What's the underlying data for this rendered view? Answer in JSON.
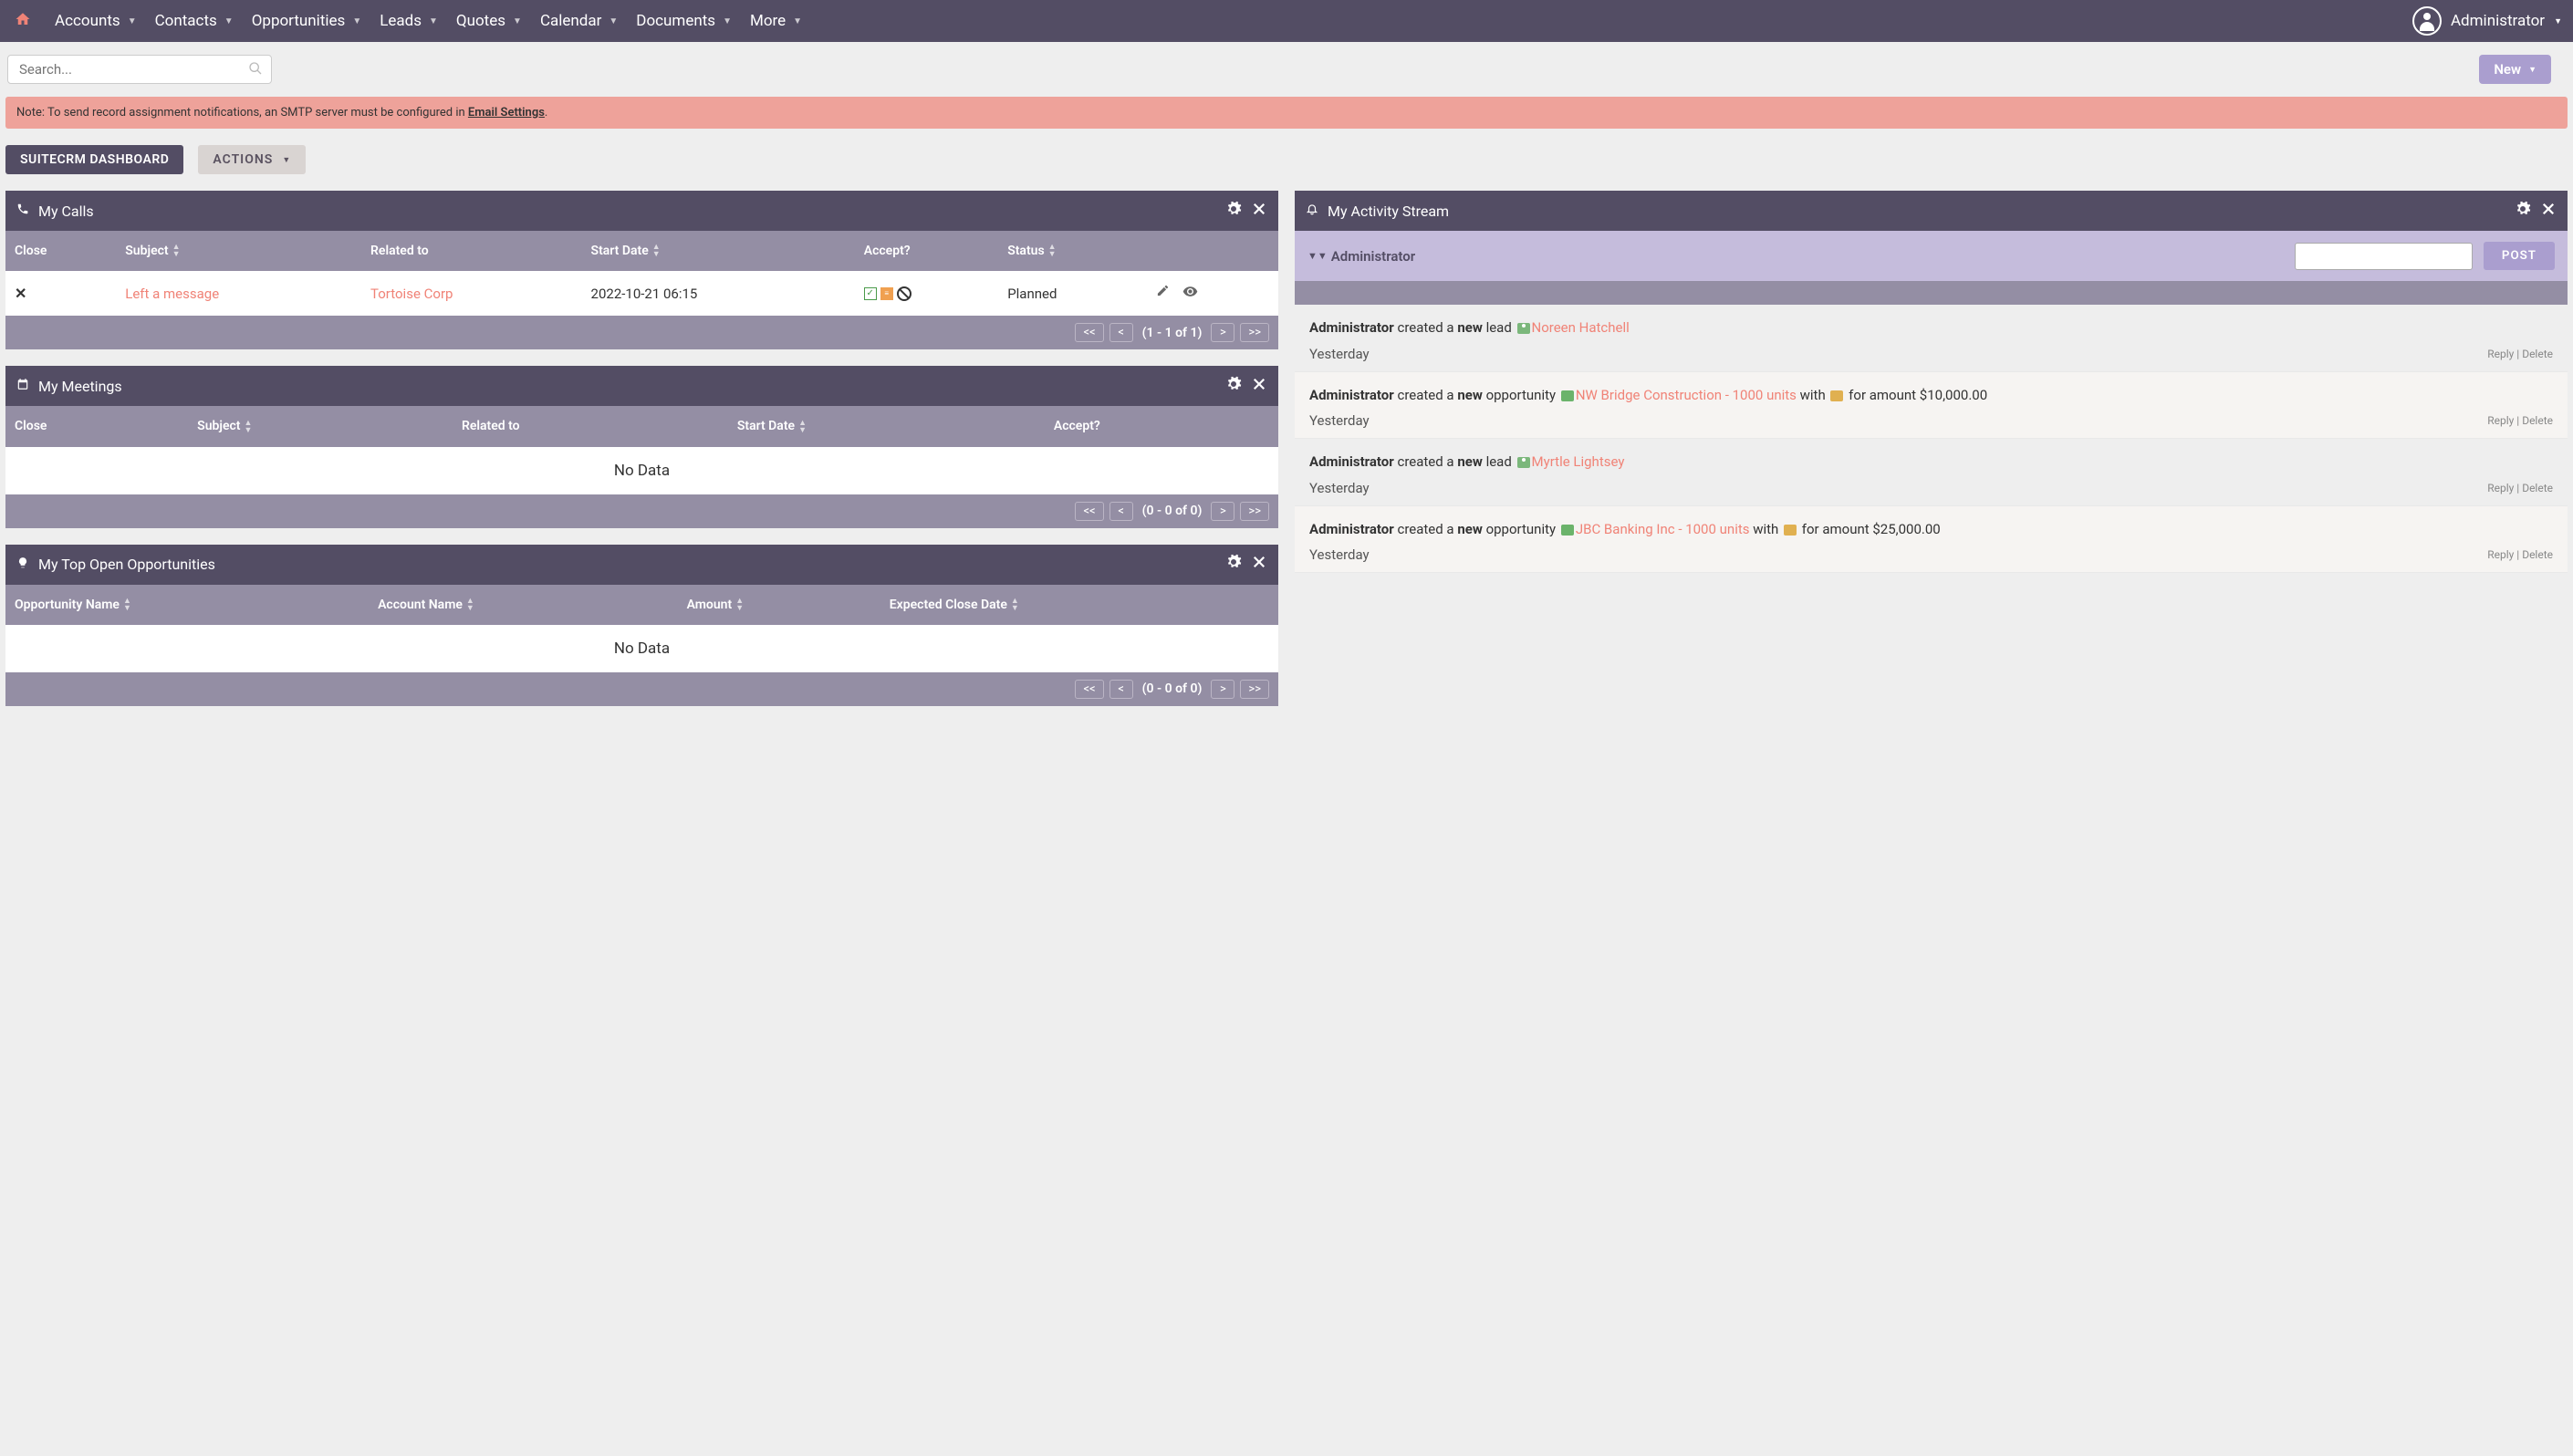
{
  "nav": {
    "items": [
      "Accounts",
      "Contacts",
      "Opportunities",
      "Leads",
      "Quotes",
      "Calendar",
      "Documents",
      "More"
    ],
    "user": "Administrator"
  },
  "search": {
    "placeholder": "Search..."
  },
  "new_btn": "New",
  "alert": {
    "prefix": "Note: To send record assignment notifications, an SMTP server must be configured in ",
    "link": "Email Settings",
    "suffix": "."
  },
  "dash_title": "SUITECRM DASHBOARD",
  "actions_btn": "ACTIONS",
  "labels": {
    "no_data": "No Data",
    "reply": "Reply",
    "delete": "Delete",
    "yesterday": "Yesterday",
    "post": "POST",
    "sep": " | "
  },
  "pager_btns": {
    "first": "<<",
    "prev": "<",
    "next": ">",
    "last": ">>"
  },
  "calls": {
    "title": "My Calls",
    "headers": {
      "close": "Close",
      "subject": "Subject",
      "related": "Related to",
      "start": "Start Date",
      "accept": "Accept?",
      "status": "Status"
    },
    "row": {
      "subject": "Left a message",
      "related": "Tortoise Corp",
      "start": "2022-10-21 06:15",
      "status": "Planned"
    },
    "pager": "(1 - 1 of 1)"
  },
  "meetings": {
    "title": "My Meetings",
    "headers": {
      "close": "Close",
      "subject": "Subject",
      "related": "Related to",
      "start": "Start Date",
      "accept": "Accept?"
    },
    "pager": "(0 - 0 of 0)"
  },
  "opps": {
    "title": "My Top Open Opportunities",
    "headers": {
      "name": "Opportunity Name",
      "account": "Account Name",
      "amount": "Amount",
      "close": "Expected Close Date"
    },
    "pager": "(0 - 0 of 0)"
  },
  "activity": {
    "title": "My Activity Stream",
    "user": "Administrator",
    "items": [
      {
        "actor": "Administrator",
        "verb": " created a ",
        "new": "new",
        "type": " lead ",
        "link": "Noreen Hatchell",
        "tail": "",
        "time": "Yesterday",
        "kind": "lead"
      },
      {
        "actor": "Administrator",
        "verb": " created a ",
        "new": "new",
        "type": " opportunity ",
        "link": "NW Bridge Construction - 1000 units",
        "tail_pre": " with ",
        "tail_post": " for amount $10,000.00",
        "time": "Yesterday",
        "kind": "opp"
      },
      {
        "actor": "Administrator",
        "verb": " created a ",
        "new": "new",
        "type": " lead ",
        "link": "Myrtle Lightsey",
        "tail": "",
        "time": "Yesterday",
        "kind": "lead"
      },
      {
        "actor": "Administrator",
        "verb": " created a ",
        "new": "new",
        "type": " opportunity ",
        "link": "JBC Banking Inc - 1000 units",
        "tail_pre": " with ",
        "tail_post": " for amount $25,000.00",
        "time": "Yesterday",
        "kind": "opp"
      }
    ]
  }
}
